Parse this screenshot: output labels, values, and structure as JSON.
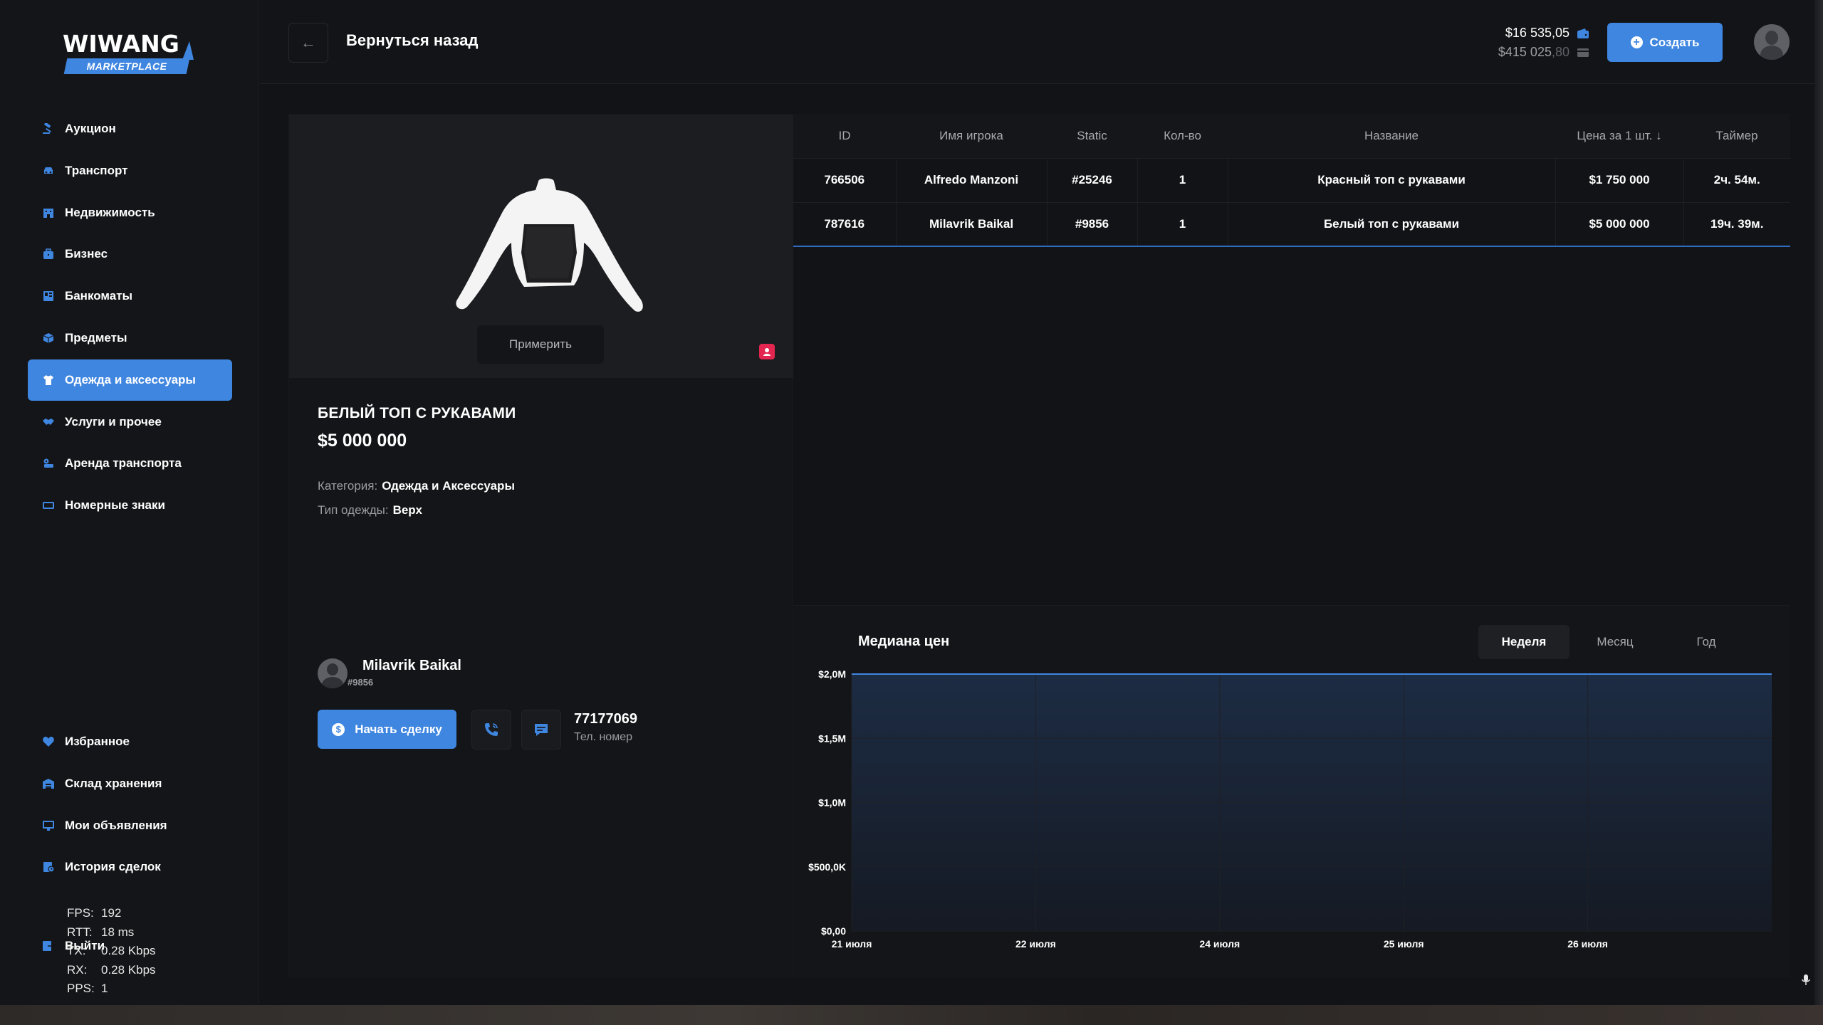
{
  "logo": {
    "top": "WIWANG",
    "sub": "MARKETPLACE"
  },
  "nav": {
    "items": [
      {
        "label": "Аукцион",
        "icon": "gavel-icon",
        "active": false
      },
      {
        "label": "Транспорт",
        "icon": "car-icon",
        "active": false
      },
      {
        "label": "Недвижимость",
        "icon": "building-icon",
        "active": false
      },
      {
        "label": "Бизнес",
        "icon": "briefcase-icon",
        "active": false
      },
      {
        "label": "Банкоматы",
        "icon": "atm-icon",
        "active": false
      },
      {
        "label": "Предметы",
        "icon": "box-icon",
        "active": false
      },
      {
        "label": "Одежда и аксессуары",
        "icon": "tshirt-icon",
        "active": true
      },
      {
        "label": "Услуги и прочее",
        "icon": "handshake-icon",
        "active": false
      },
      {
        "label": "Аренда транспорта",
        "icon": "car-key-icon",
        "active": false
      },
      {
        "label": "Номерные знаки",
        "icon": "license-plate-icon",
        "active": false
      }
    ],
    "bottom": [
      {
        "label": "Избранное",
        "icon": "heart-icon"
      },
      {
        "label": "Склад хранения",
        "icon": "warehouse-icon"
      },
      {
        "label": "Мои объявления",
        "icon": "monitor-icon"
      },
      {
        "label": "История сделок",
        "icon": "history-icon"
      }
    ],
    "exit_label": "Выйти"
  },
  "stats": {
    "fps_k": "FPS:",
    "fps_v": "192",
    "rtt_k": "RTT:",
    "rtt_v": "18 ms",
    "tx_k": "TX:",
    "tx_v": "0.28 Kbps",
    "rx_k": "RX:",
    "rx_v": "0.28 Kbps",
    "pps_k": "PPS:",
    "pps_v": "1"
  },
  "header": {
    "back_label": "Вернуться назад",
    "balance_main": "$16 535,05",
    "balance_bank": "$415 025",
    "balance_bank_cents": ",80",
    "create_label": "Создать"
  },
  "item": {
    "try_label": "Примерить",
    "title": "БЕЛЫЙ ТОП С РУКАВАМИ",
    "price": "$5 000 000",
    "category_label": "Категория:",
    "category_value": "Одежда и Аксессуары",
    "type_label": "Тип одежды:",
    "type_value": "Верх",
    "seller_name": "Milavrik Baikal",
    "seller_static": "#9856",
    "start_deal_label": "Начать сделку",
    "phone": "77177069",
    "phone_label": "Тел. номер"
  },
  "table": {
    "columns": [
      "ID",
      "Имя игрока",
      "Static",
      "Кол-во",
      "Название",
      "Цена за 1 шт.",
      "Таймер"
    ],
    "rows": [
      [
        "766506",
        "Alfredo Manzoni",
        "#25246",
        "1",
        "Красный топ с рукавами",
        "$1 750 000",
        "2ч. 54м."
      ],
      [
        "787616",
        "Milavrik Baikal",
        "#9856",
        "1",
        "Белый топ с рукавами",
        "$5 000 000",
        "19ч. 39м."
      ]
    ]
  },
  "chart_data": {
    "type": "area",
    "title": "Медиана цен",
    "x": [
      "21 июля",
      "22 июля",
      "24 июля",
      "25 июля",
      "26 июля"
    ],
    "series": [
      {
        "values": [
          2000000,
          2000000,
          2000000,
          2000000,
          2000000,
          2000000
        ]
      }
    ],
    "y_ticks": [
      "$2,0M",
      "$1,5M",
      "$1,0M",
      "$500,0K",
      "$0,00"
    ],
    "ylim": [
      0,
      2000000
    ],
    "grid": true,
    "colors": {
      "line": "#3f86e0",
      "fill": "#1c2c44"
    },
    "range_tabs": [
      "Неделя",
      "Месяц",
      "Год"
    ],
    "active_range": "Неделя"
  },
  "colors": {
    "accent": "#3f86e0",
    "badge": "#e3264f",
    "bg": "#121316"
  }
}
